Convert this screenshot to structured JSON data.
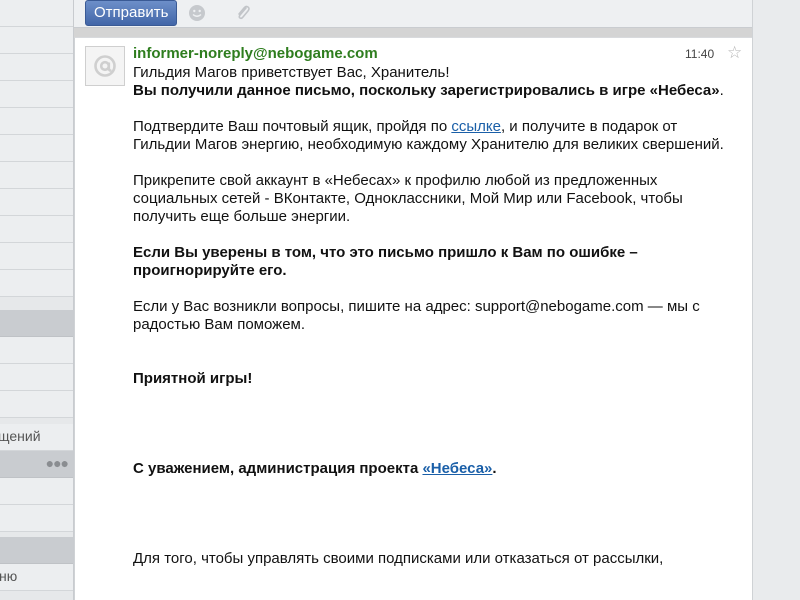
{
  "toolbar": {
    "send_label": "Отправить",
    "emoji_icon": "smiley-icon",
    "attach_icon": "paperclip-icon"
  },
  "sidebar": {
    "partial_labels": [
      "щений",
      "ню"
    ]
  },
  "message": {
    "sender": "informer-noreply@nebogame.com",
    "time": "11:40",
    "greeting": "Гильдия Магов приветствует Вас, Хранитель!",
    "intro_bold_1": "Вы получили данное письмо, поскольку зарегистрировались в игре «Небеса»",
    "intro_bold_2": ".",
    "p2_before": "Подтвердите Ваш почтовый ящик, пройдя по ",
    "p2_link": "ссылке",
    "p2_after": ", и получите в подарок от Гильдии Магов энергию, необходимую каждому Хранителю для великих свершений.",
    "p3": "Прикрепите свой аккаунт в «Небесах» к профилю любой из предложенных социальных сетей - ВКонтакте, Одноклассники, Мой Мир или Facebook, чтобы получить еще больше энергии.",
    "p4": "Если Вы уверены в том, что это письмо пришло к Вам по ошибке – проигнорируйте его.",
    "p5": "Если у Вас возникли вопросы, пишите на адрес: support@nebogame.com — мы с радостью Вам поможем.",
    "p6": "Приятной игры!",
    "sign_before": "С уважением, администрация проекта ",
    "sign_link": "«Небеса»",
    "sign_after": ".",
    "footer": "Для того, чтобы управлять своими подписками или отказаться от рассылки,"
  },
  "colors": {
    "sender": "#2e7d1e",
    "link": "#1a5fa8",
    "send_button": "#4266a8"
  }
}
